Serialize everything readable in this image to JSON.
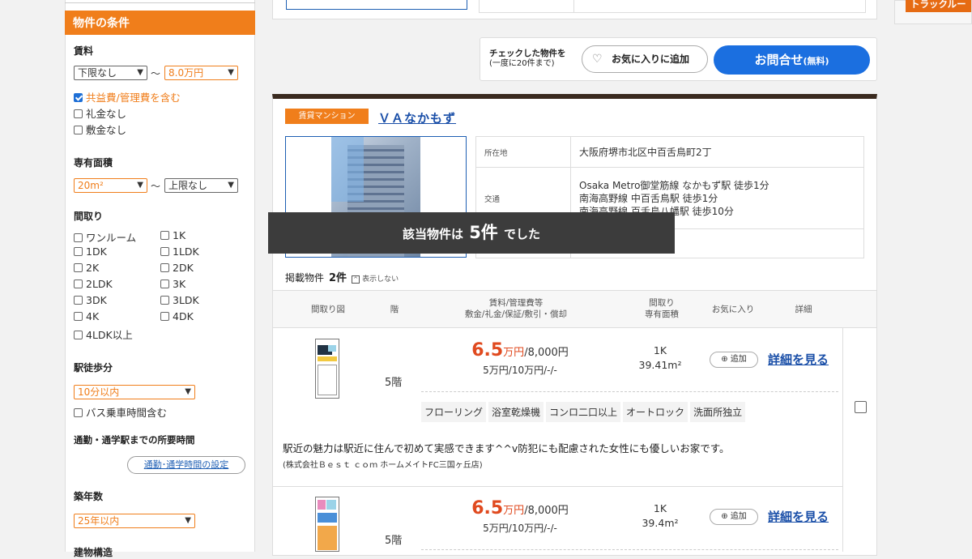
{
  "sidebar": {
    "title": "物件の条件",
    "rent": {
      "label": "賃料",
      "min": "下限なし",
      "max": "8.0万円",
      "tilde": "～",
      "options": [
        "共益費/管理費を含む",
        "礼金なし",
        "敷金なし"
      ]
    },
    "area": {
      "label": "専有面積",
      "min": "20m²",
      "max": "上限なし",
      "tilde": "～"
    },
    "layout": {
      "label": "間取り",
      "options": [
        "ワンルーム",
        "1K",
        "1DK",
        "1LDK",
        "2K",
        "2DK",
        "2LDK",
        "3K",
        "3DK",
        "3LDK",
        "4K",
        "4DK",
        "4LDK以上"
      ]
    },
    "walk": {
      "label": "駅徒歩分",
      "value": "10分以内",
      "bus": "バス乗車時間含む"
    },
    "commute": {
      "label": "通勤・通学駅までの所要時間",
      "button": "通勤･通学時間の設定"
    },
    "age": {
      "label": "築年数",
      "value": "25年以内"
    },
    "structure": {
      "label": "建物構造"
    }
  },
  "actions": {
    "checked_label": "チェックした物件を",
    "checked_note": "(一度に20件まで)",
    "favorite": "お気に入りに追加",
    "inquiry": "お問合せ",
    "inquiry_note": "(無料)"
  },
  "property": {
    "type": "賃貸マンション",
    "name": "ＶＡなかもず",
    "address_label": "所在地",
    "address": "大阪府堺市北区中百舌鳥町2丁",
    "access_label": "交通",
    "access": [
      "Osaka Metro御堂筋線 なかもず駅 徒歩1分",
      "南海高野線 中百舌鳥駅 徒歩1分",
      "南海高野線 百舌鳥八幡駅 徒歩10分"
    ]
  },
  "overlay": {
    "prefix": "該当物件は",
    "count": "5件",
    "suffix": "でした"
  },
  "listing": {
    "label": "掲載物件",
    "count": "2件",
    "hide": "表示しない"
  },
  "table": {
    "headers": {
      "plan": "間取り図",
      "floor": "階",
      "rent1": "賃料/管理費等",
      "rent2": "敷金/礼金/保証/敷引・償却",
      "layout1": "間取り",
      "layout2": "専有面積",
      "fav": "お気に入り",
      "detail": "詳細"
    },
    "rows": [
      {
        "floor": "5階",
        "rent": "6.5",
        "unit": "万円",
        "mgmt": "/8,000円",
        "deposits": "5万円/10万円/-/-",
        "layout": "1K",
        "area": "39.41m²",
        "add": "追加",
        "detail": "詳細を見る",
        "tags": [
          "フローリング",
          "浴室乾燥機",
          "コンロ二口以上",
          "オートロック",
          "洗面所独立"
        ],
        "desc": "駅近の魅力は駅近に住んで初めて実感できます^^v防犯にも配慮された女性にも優しいお家です。",
        "agent": "(株式会社Ｂｅｓｔ ｃｏｍ ホームメイトFC三国ヶ丘店)"
      },
      {
        "floor": "5階",
        "rent": "6.5",
        "unit": "万円",
        "mgmt": "/8,000円",
        "deposits": "5万円/10万円/-/-",
        "layout": "1K",
        "area": "39.4m²",
        "add": "追加",
        "detail": "詳細を見る"
      }
    ]
  },
  "right_tab": {
    "label": "トラックルー"
  }
}
